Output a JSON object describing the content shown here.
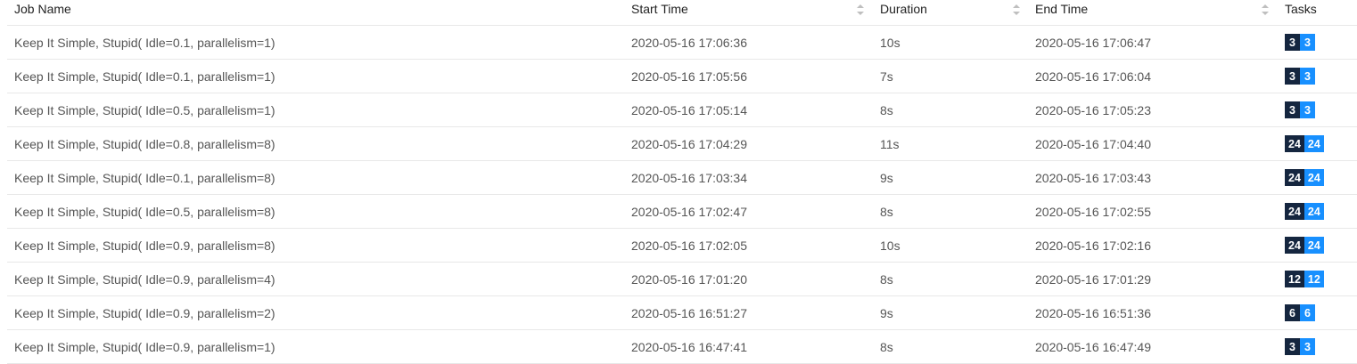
{
  "table": {
    "columns": {
      "job_name": "Job Name",
      "start_time": "Start Time",
      "duration": "Duration",
      "end_time": "End Time",
      "tasks": "Tasks"
    },
    "rows": [
      {
        "name": "Keep It Simple, Stupid( Idle=0.1, parallelism=1)",
        "start": "2020-05-16 17:06:36",
        "duration": "10s",
        "end": "2020-05-16 17:06:47",
        "tasks_a": "3",
        "tasks_b": "3"
      },
      {
        "name": "Keep It Simple, Stupid( Idle=0.1, parallelism=1)",
        "start": "2020-05-16 17:05:56",
        "duration": "7s",
        "end": "2020-05-16 17:06:04",
        "tasks_a": "3",
        "tasks_b": "3"
      },
      {
        "name": "Keep It Simple, Stupid( Idle=0.5, parallelism=1)",
        "start": "2020-05-16 17:05:14",
        "duration": "8s",
        "end": "2020-05-16 17:05:23",
        "tasks_a": "3",
        "tasks_b": "3"
      },
      {
        "name": "Keep It Simple, Stupid( Idle=0.8, parallelism=8)",
        "start": "2020-05-16 17:04:29",
        "duration": "11s",
        "end": "2020-05-16 17:04:40",
        "tasks_a": "24",
        "tasks_b": "24"
      },
      {
        "name": "Keep It Simple, Stupid( Idle=0.1, parallelism=8)",
        "start": "2020-05-16 17:03:34",
        "duration": "9s",
        "end": "2020-05-16 17:03:43",
        "tasks_a": "24",
        "tasks_b": "24"
      },
      {
        "name": "Keep It Simple, Stupid( Idle=0.5, parallelism=8)",
        "start": "2020-05-16 17:02:47",
        "duration": "8s",
        "end": "2020-05-16 17:02:55",
        "tasks_a": "24",
        "tasks_b": "24"
      },
      {
        "name": "Keep It Simple, Stupid( Idle=0.9, parallelism=8)",
        "start": "2020-05-16 17:02:05",
        "duration": "10s",
        "end": "2020-05-16 17:02:16",
        "tasks_a": "24",
        "tasks_b": "24"
      },
      {
        "name": "Keep It Simple, Stupid( Idle=0.9, parallelism=4)",
        "start": "2020-05-16 17:01:20",
        "duration": "8s",
        "end": "2020-05-16 17:01:29",
        "tasks_a": "12",
        "tasks_b": "12"
      },
      {
        "name": "Keep It Simple, Stupid( Idle=0.9, parallelism=2)",
        "start": "2020-05-16 16:51:27",
        "duration": "9s",
        "end": "2020-05-16 16:51:36",
        "tasks_a": "6",
        "tasks_b": "6"
      },
      {
        "name": "Keep It Simple, Stupid( Idle=0.9, parallelism=1)",
        "start": "2020-05-16 16:47:41",
        "duration": "8s",
        "end": "2020-05-16 16:47:49",
        "tasks_a": "3",
        "tasks_b": "3"
      }
    ]
  },
  "icons": {
    "sort": "sort-caret-icon"
  },
  "colors": {
    "tag_dark": "#15263f",
    "tag_blue": "#1890ff",
    "row_border": "#e8e8e8"
  }
}
